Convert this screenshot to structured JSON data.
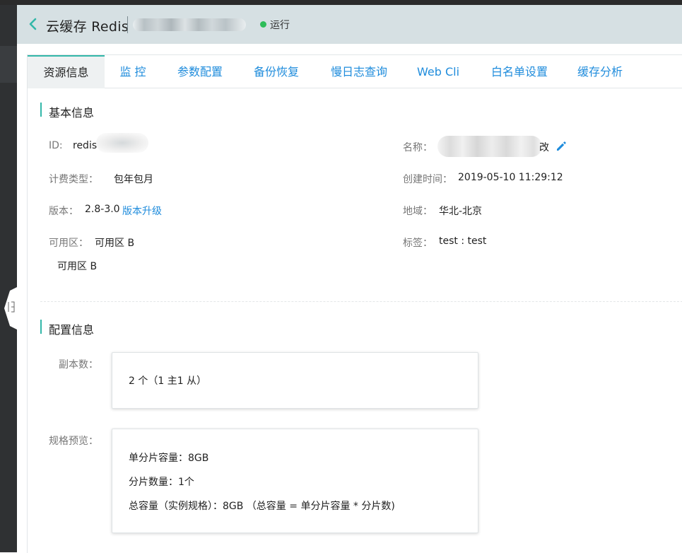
{
  "header": {
    "title": "云缓存 Redis",
    "status": "运行",
    "status_color": "#2ebd59"
  },
  "tabs": [
    {
      "label": "资源信息",
      "active": true
    },
    {
      "label": "监 控"
    },
    {
      "label": "参数配置"
    },
    {
      "label": "备份恢复"
    },
    {
      "label": "慢日志查询"
    },
    {
      "label": "Web Cli"
    },
    {
      "label": "白名单设置"
    },
    {
      "label": "缓存分析"
    }
  ],
  "basic": {
    "title": "基本信息",
    "id_label": "ID:",
    "id_value": "redis",
    "name_label": "名称：",
    "name_suffix": "改",
    "billing_label": "计费类型：",
    "billing_value": "包年包月",
    "created_label": "创建时间：",
    "created_value": "2019-05-10 11:29:12",
    "version_label": "版本：",
    "version_value": "2.8-3.0",
    "upgrade_link": "版本升级",
    "region_label": "地域：",
    "region_value": "华北-北京",
    "az_label": "可用区：",
    "az_value": "可用区 B",
    "az_value2": "可用区 B",
    "tags_label": "标签：",
    "tags_value": "test : test"
  },
  "config": {
    "title": "配置信息",
    "replica_label": "副本数：",
    "replica_value": "2 个（1 主1 从）",
    "spec_label": "规格预览：",
    "spec_lines": [
      "单分片容量：8GB",
      "分片数量：1个",
      "总容量（实例规格）：8GB （总容量 = 单分片容量 * 分片数)"
    ]
  },
  "colors": {
    "accent": "#33b7a9",
    "link": "#1f8cdc",
    "header_bg": "#d6e0e3"
  }
}
